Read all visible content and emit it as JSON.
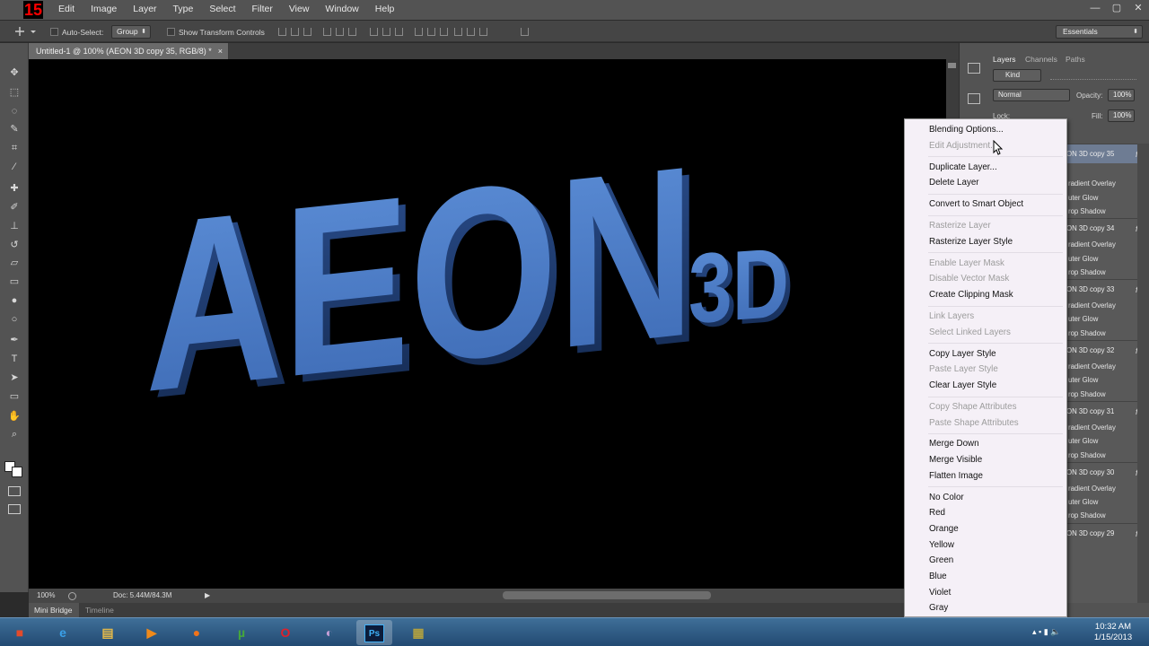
{
  "app": {
    "logo_text": "15",
    "colors": {
      "menubar": "#535353",
      "canvas": "#000000",
      "context_menu_bg": "#f5f0f7",
      "text_blue": "#4a7cc8"
    }
  },
  "menubar": {
    "items": [
      "Edit",
      "Image",
      "Layer",
      "Type",
      "Select",
      "Filter",
      "View",
      "Window",
      "Help"
    ]
  },
  "window_controls": {
    "minimize": "—",
    "maximize": "▢",
    "close": "✕"
  },
  "options": {
    "auto_select_label": "Auto-Select:",
    "auto_select_value": "Group",
    "transform_label": "Show Transform Controls",
    "workspace": "Essentials"
  },
  "document": {
    "tab_title": "Untitled-1 @ 100% (AEON 3D copy 35, RGB/8) *",
    "close": "×",
    "canvas_text_main": "AEON",
    "canvas_text_sub": "3D"
  },
  "status": {
    "zoom": "100%",
    "doc_info": "Doc: 5.44M/84.3M"
  },
  "bottom_tabs": [
    "Mini Bridge",
    "Timeline"
  ],
  "panels": {
    "tabs": [
      "Layers",
      "Channels",
      "Paths"
    ],
    "kind_label": "Kind",
    "blend_mode": "Normal",
    "opacity_label": "Opacity:",
    "opacity_value": "100%",
    "lock_label": "Lock:",
    "fill_label": "Fill:",
    "fill_value": "100%",
    "fx_label": "fx"
  },
  "layers": [
    {
      "name": "ON 3D copy 35",
      "effects": [
        "",
        "radient Overlay",
        "uter Glow",
        "rop Shadow"
      ]
    },
    {
      "name": "ON 3D copy 34",
      "effects": [
        "radient Overlay",
        "uter Glow",
        "rop Shadow"
      ]
    },
    {
      "name": "ON 3D copy 33",
      "effects": [
        "radient Overlay",
        "uter Glow",
        "rop Shadow"
      ]
    },
    {
      "name": "ON 3D copy 32",
      "effects": [
        "radient Overlay",
        "uter Glow",
        "rop Shadow"
      ]
    },
    {
      "name": "ON 3D copy 31",
      "effects": [
        "radient Overlay",
        "uter Glow",
        "rop Shadow"
      ]
    },
    {
      "name": "ON 3D copy 30",
      "effects": [
        "radient Overlay",
        "uter Glow",
        "rop Shadow"
      ]
    },
    {
      "name": "ON 3D copy 29",
      "effects": []
    }
  ],
  "context_menu": [
    {
      "label": "Blending Options...",
      "disabled": false
    },
    {
      "label": "Edit Adjustment...",
      "disabled": true
    },
    {
      "sep": true
    },
    {
      "label": "Duplicate Layer...",
      "disabled": false
    },
    {
      "label": "Delete Layer",
      "disabled": false
    },
    {
      "sep": true
    },
    {
      "label": "Convert to Smart Object",
      "disabled": false
    },
    {
      "sep": true
    },
    {
      "label": "Rasterize Layer",
      "disabled": true
    },
    {
      "label": "Rasterize Layer Style",
      "disabled": false
    },
    {
      "sep": true
    },
    {
      "label": "Enable Layer Mask",
      "disabled": true
    },
    {
      "label": "Disable Vector Mask",
      "disabled": true
    },
    {
      "label": "Create Clipping Mask",
      "disabled": false
    },
    {
      "sep": true
    },
    {
      "label": "Link Layers",
      "disabled": true
    },
    {
      "label": "Select Linked Layers",
      "disabled": true
    },
    {
      "sep": true
    },
    {
      "label": "Copy Layer Style",
      "disabled": false
    },
    {
      "label": "Paste Layer Style",
      "disabled": true
    },
    {
      "label": "Clear Layer Style",
      "disabled": false
    },
    {
      "sep": true
    },
    {
      "label": "Copy Shape Attributes",
      "disabled": true
    },
    {
      "label": "Paste Shape Attributes",
      "disabled": true
    },
    {
      "sep": true
    },
    {
      "label": "Merge Down",
      "disabled": false
    },
    {
      "label": "Merge Visible",
      "disabled": false
    },
    {
      "label": "Flatten Image",
      "disabled": false
    },
    {
      "sep": true
    },
    {
      "label": "No Color",
      "disabled": false
    },
    {
      "label": "Red",
      "disabled": false
    },
    {
      "label": "Orange",
      "disabled": false
    },
    {
      "label": "Yellow",
      "disabled": false
    },
    {
      "label": "Green",
      "disabled": false
    },
    {
      "label": "Blue",
      "disabled": false
    },
    {
      "label": "Violet",
      "disabled": false
    },
    {
      "label": "Gray",
      "disabled": false
    }
  ],
  "tools": [
    "move-tool-icon",
    "marquee-tool-icon",
    "lasso-tool-icon",
    "quick-select-tool-icon",
    "crop-tool-icon",
    "eyedropper-tool-icon",
    "healing-brush-icon",
    "brush-tool-icon",
    "clone-stamp-icon",
    "history-brush-icon",
    "eraser-tool-icon",
    "gradient-tool-icon",
    "blur-tool-icon",
    "dodge-tool-icon",
    "pen-tool-icon",
    "type-tool-icon",
    "path-select-icon",
    "shape-tool-icon",
    "hand-tool-icon",
    "zoom-tool-icon"
  ],
  "taskbar": {
    "apps": [
      "start-button",
      "ie-icon",
      "explorer-icon",
      "media-player-icon",
      "firefox-icon",
      "utorrent-icon",
      "opera-icon",
      "paint-icon",
      "photoshop-icon",
      "archive-icon"
    ],
    "ps_label": "Ps",
    "time": "10:32 AM",
    "date": "1/15/2013"
  }
}
